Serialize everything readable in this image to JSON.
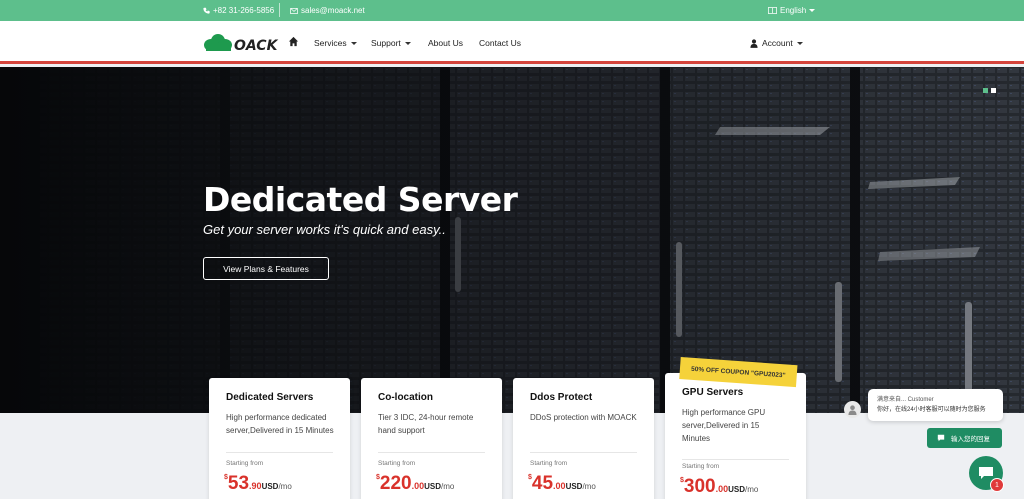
{
  "topbar": {
    "phone": "+82 31-266-5856",
    "email": "sales@moack.net",
    "language": "English"
  },
  "nav": {
    "logo_text": "OACK",
    "items": [
      {
        "label": "Services",
        "dropdown": true
      },
      {
        "label": "Support",
        "dropdown": true
      },
      {
        "label": "About Us",
        "dropdown": false
      },
      {
        "label": "Contact Us",
        "dropdown": false
      }
    ],
    "account": "Account"
  },
  "hero": {
    "title": "Dedicated Server",
    "subtitle": "Get your server works it's quick and easy..",
    "button": "View Plans & Features"
  },
  "cards": [
    {
      "title": "Dedicated Servers",
      "desc": "High performance dedicated server,Delivered in 15 Minutes",
      "starting": "Starting from",
      "currency": "$",
      "int": "53",
      "dec": ".90",
      "usd": "USD",
      "per": "/mo"
    },
    {
      "title": "Co-location",
      "desc": "Tier 3 IDC, 24-hour remote hand support",
      "starting": "Starting from",
      "currency": "$",
      "int": "220",
      "dec": ".00",
      "usd": "USD",
      "per": "/mo"
    },
    {
      "title": "Ddos Protect",
      "desc": "DDoS protection with MOACK",
      "starting": "Starting from",
      "currency": "$",
      "int": "45",
      "dec": ".00",
      "usd": "USD",
      "per": "/mo"
    },
    {
      "title": "GPU Servers",
      "desc": "High performance GPU server,Delivered in 15 Minutes",
      "starting": "Starting from",
      "currency": "$",
      "int": "300",
      "dec": ".00",
      "usd": "USD",
      "per": "/mo"
    }
  ],
  "coupon": "50% OFF COUPON \"GPU2023\"",
  "chat": {
    "name_line": "满意来自... Customer",
    "message": "你好，在线24小时客服可以随时为您服务",
    "action": "输入您的回复",
    "badge": "1"
  },
  "colors": {
    "topbar": "#5dbf8c",
    "accent_red": "#d4443c",
    "price_red": "#d9322b",
    "chat_green": "#1f8c63",
    "coupon_yellow": "#f5d23a"
  }
}
